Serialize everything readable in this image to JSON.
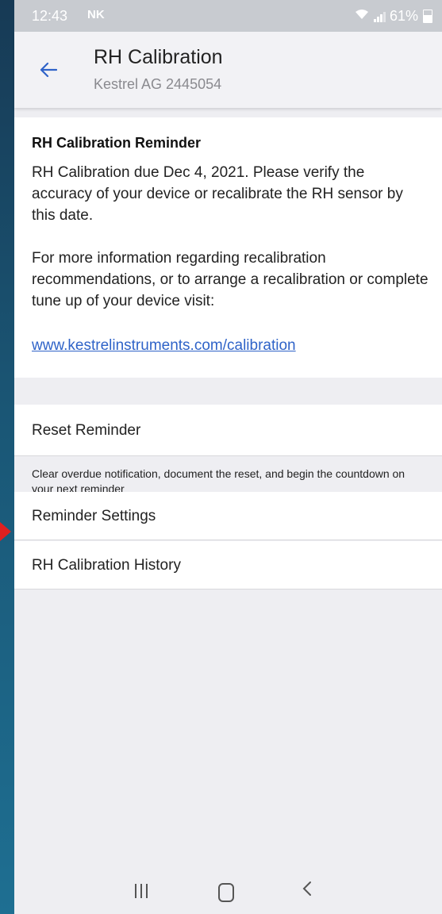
{
  "status_bar": {
    "time": "12:43",
    "notification_glyph": "NK",
    "battery": "61%"
  },
  "header": {
    "title": "RH Calibration",
    "subtitle": "Kestrel AG 2445054"
  },
  "reminder": {
    "heading": "RH Calibration Reminder",
    "body": "RH Calibration due Dec 4, 2021. Please verify the accuracy of your device or recalibrate the RH sensor by this date.",
    "more_info": "For more information regarding recalibration recommendations, or to arrange a recalibration or complete tune up of your device visit:",
    "link": "www.kestrelinstruments.com/calibration"
  },
  "actions": {
    "reset_label": "Reset Reminder",
    "reset_description": "Clear overdue notification, document the reset, and begin the countdown on your next reminder",
    "settings_label": "Reminder Settings",
    "history_label": "RH Calibration History"
  },
  "colors": {
    "accent": "#2f63c8",
    "pointer": "#e02020"
  },
  "icons": {
    "back": "back-arrow-icon",
    "wifi": "wifi-icon",
    "signal": "signal-icon",
    "battery": "battery-icon",
    "nav_recent": "recent-apps-icon",
    "nav_home": "home-icon",
    "nav_back": "nav-back-icon"
  }
}
